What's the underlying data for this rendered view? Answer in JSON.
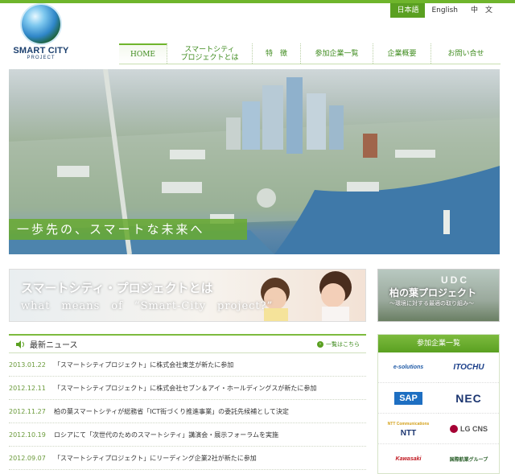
{
  "header": {
    "logo_main": "SMART CITY",
    "logo_sub": "PROJECT",
    "languages": [
      "日本語",
      "English",
      "中　文"
    ],
    "active_language": "日本語"
  },
  "nav": {
    "items": [
      "HOME",
      "スマートシティ\nプロジェクトとは",
      "特　徴",
      "参加企業一覧",
      "企業概要",
      "お問い合せ"
    ]
  },
  "hero": {
    "tagline": "一歩先の、スマートな未来へ"
  },
  "promo": {
    "about_title_ja": "スマートシティ・プロジェクトとは",
    "about_title_en": "what　means　of　“Smart-City　project?”",
    "kashiwa_title": "柏の葉プロジェクト",
    "kashiwa_sub": "〜環境に対する最適の取り組み〜",
    "kashiwa_sign": "UDC"
  },
  "news": {
    "title": "最新ニュース",
    "more": "一覧はこちら",
    "items": [
      {
        "date": "2013.01.22",
        "text": "「スマートシティプロジェクト」に株式会社東芝が新たに参加"
      },
      {
        "date": "2012.12.11",
        "text": "「スマートシティプロジェクト」に株式会社セブン＆アイ・ホールディングスが新たに参加"
      },
      {
        "date": "2012.11.27",
        "text": "柏の葉スマートシティが総務省「ICT街づくり推進事業」の委託先候補として決定"
      },
      {
        "date": "2012.10.19",
        "text": "ロシアにて「次世代のためのスマートシティ」講演会・展示フォーラムを実施"
      },
      {
        "date": "2012.09.07",
        "text": "「スマートシティプロジェクト」にリーディング企業2社が新たに参加"
      }
    ]
  },
  "partners": {
    "title": "参加企業一覧",
    "logos": [
      "e-solutions",
      "ITOCHU",
      "SAP",
      "NEC",
      "NTT Communications",
      "NTT",
      "LG CNS",
      "Kawasaki",
      "国際航業グループ"
    ]
  },
  "colors": {
    "brand_green": "#5aa021",
    "nav_text": "#3e8b1d",
    "logo_blue": "#1b3f6e"
  }
}
